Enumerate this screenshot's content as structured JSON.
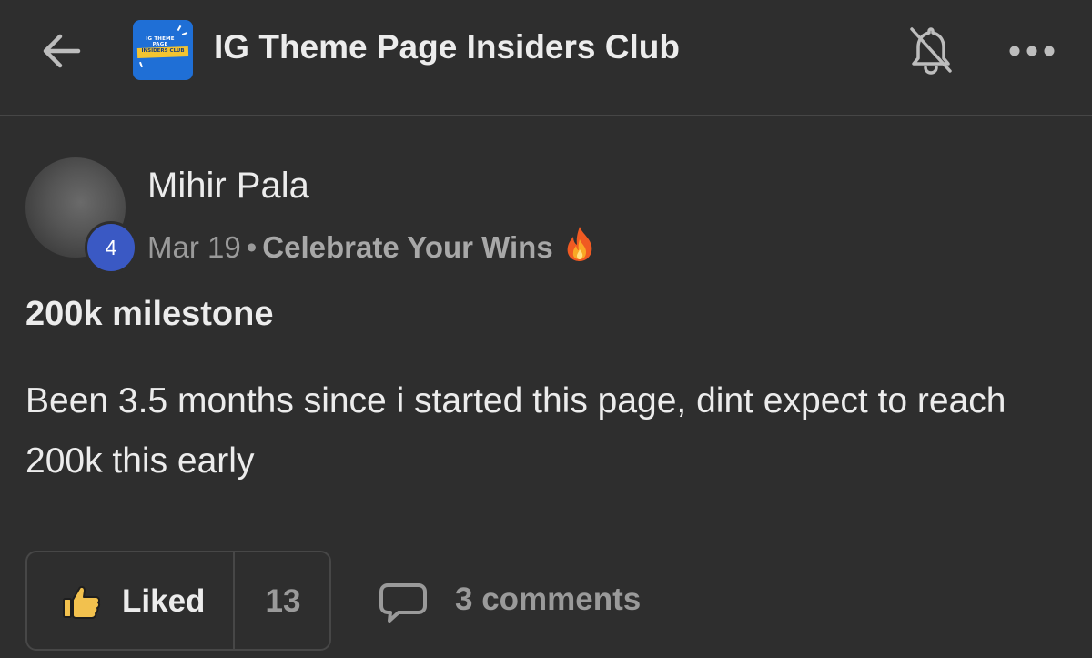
{
  "header": {
    "group_name": "IG Theme Page Insiders Club",
    "logo_text_top": "IG THEME PAGE",
    "logo_text_bottom": "INSIDERS CLUB",
    "back_icon": "arrow-left-icon",
    "mute_icon": "bell-off-icon",
    "more_icon": "more-horizontal-icon"
  },
  "post": {
    "author": {
      "name": "Mihir Pala",
      "level": "4"
    },
    "date": "Mar 19",
    "separator": "•",
    "category": "Celebrate Your Wins",
    "category_icon": "fire-emoji",
    "title": "200k milestone",
    "body": "Been 3.5 months since i started this page, dint expect to reach 200k this early",
    "actions": {
      "like_label": "Liked",
      "like_icon": "thumbs-up-icon",
      "like_count": "13",
      "comments_label": "3 comments",
      "comments_icon": "comment-bubble-icon"
    }
  },
  "colors": {
    "background": "#2e2e2e",
    "text_primary": "#ececec",
    "text_secondary": "#9a9a9a",
    "level_badge": "#3a59c4",
    "like_icon": "#f2c14e",
    "divider": "#464646"
  }
}
